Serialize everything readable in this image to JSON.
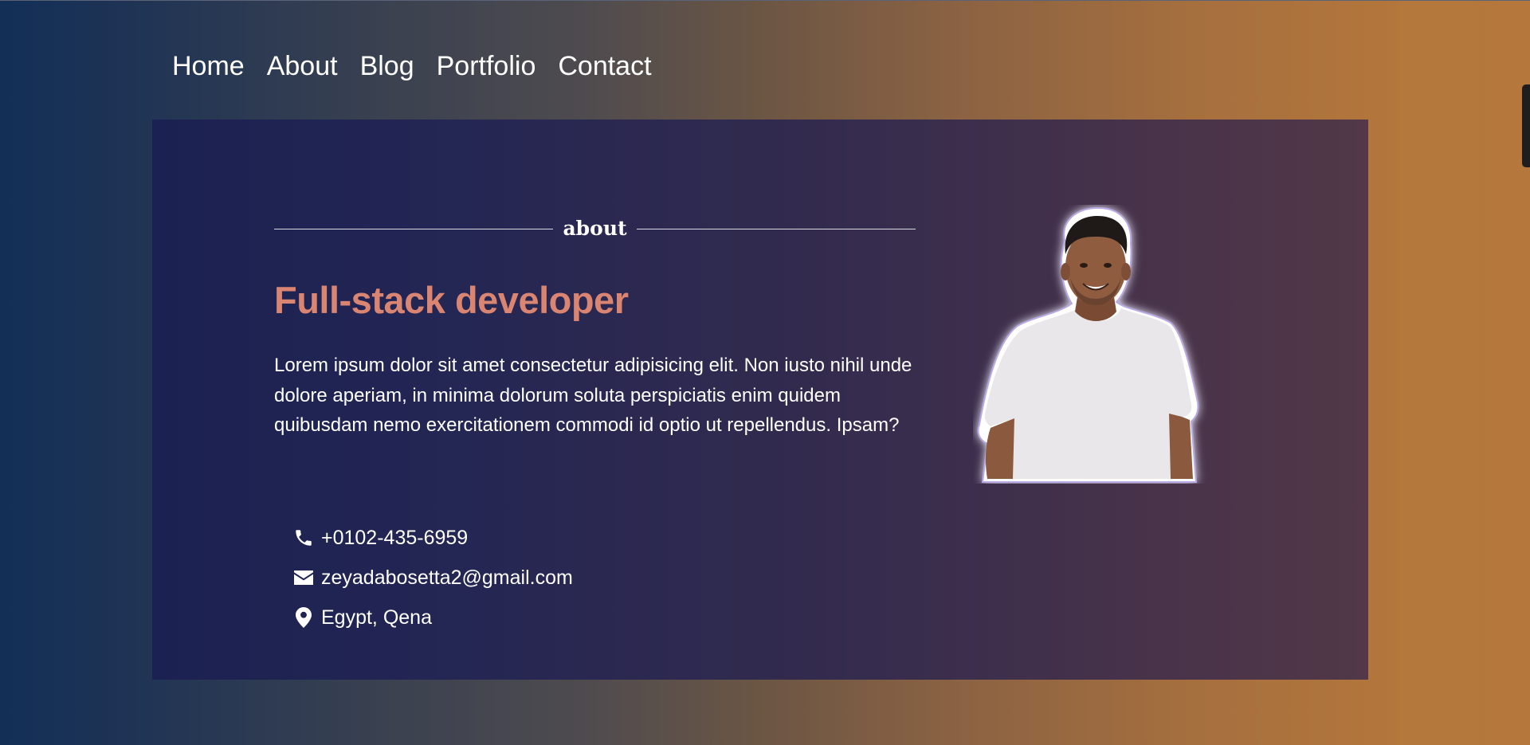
{
  "nav": {
    "items": [
      "Home",
      "About",
      "Blog",
      "Portfolio",
      "Contact"
    ]
  },
  "about": {
    "heading": "about",
    "title": "Full-stack developer",
    "bio": "Lorem ipsum dolor sit amet consectetur adipisicing elit. Non iusto nihil unde dolore aperiam, in minima dolorum soluta perspiciatis enim quidem quibusdam nemo exercitationem commodi id optio ut repellendus. Ipsam?",
    "contacts": [
      {
        "icon": "phone-icon",
        "text": "+0102-435-6959"
      },
      {
        "icon": "envelope-icon",
        "text": "zeyadabosetta2@gmail.com"
      },
      {
        "icon": "map-pin-icon",
        "text": "Egypt, Qena"
      }
    ]
  },
  "colors": {
    "accent": "#d98572",
    "panel_start": "#1b2152",
    "panel_end": "#523848",
    "bg_start": "#122f56",
    "bg_end": "#b5773b"
  }
}
